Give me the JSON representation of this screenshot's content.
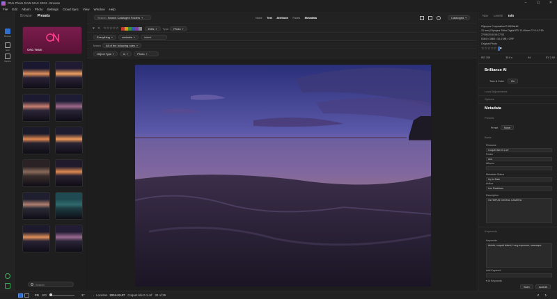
{
  "window": {
    "title": "ON1 Photo RAW MAX 2024 - Browse",
    "controls": [
      "–",
      "▢",
      "✕"
    ]
  },
  "menu": [
    "File",
    "Edit",
    "Album",
    "Photo",
    "Settings",
    "Cloud Sync",
    "View",
    "Window",
    "Help"
  ],
  "tools": [
    {
      "label": "Browse",
      "icon": "browse-icon"
    },
    {
      "label": "Edit",
      "icon": "edit-icon"
    },
    {
      "label": "Resize",
      "icon": "resize-icon"
    }
  ],
  "presets_panel": {
    "tabs": [
      "Browse",
      "Presets"
    ],
    "active_tab": "Presets",
    "featured_label": "ON1 Team",
    "search_placeholder": "Search"
  },
  "filter_bar": {
    "search_label": "Search",
    "search_scope": "Search Cataloged Folders",
    "view_tabs": [
      "None",
      "Text",
      "Attribute",
      "Faces",
      "Metadata"
    ],
    "active_view_tab": "Metadata",
    "catalog_label": "Cataloged",
    "edits_label": "Edits",
    "type_label": "Type",
    "type_value": "Photo",
    "rule_field": "Everything",
    "rule_op": "contains",
    "rule_value": "island",
    "match_label": "Match",
    "match_value": "All of the following rules",
    "rule2_field": "Object Type",
    "rule2_op": "is",
    "rule2_value": "Photo"
  },
  "right_panel": {
    "tabs": [
      "Nav",
      "Levels",
      "Info"
    ],
    "active_tab": "Info",
    "camera": "Olympus Corporation E-M1MarkII",
    "lens": "12 mm (Olympus Zuiko Digital ED 12-40mm F2.8 4-2.50",
    "date": "27/06/2016 06:27:53",
    "dims": "5184 x 3888 • 16.4 MB • ORF",
    "original": "Original Photo",
    "exif": [
      "ISO 200",
      "30.0 s",
      "f/4",
      "EV 2.00"
    ],
    "brilliance_title": "Brilliance AI",
    "tone_color_label": "Tone & Color",
    "tone_color_value": "On",
    "local_adjustments": "Local Adjustments",
    "options": "Options",
    "metadata_title": "Metadata",
    "presets_label": "Presets",
    "preset_label": "Preset",
    "preset_value": "None",
    "basic_label": "Basic",
    "fields": [
      {
        "label": "Filename",
        "value": "Coquet isle 0-1.orf"
      },
      {
        "label": "Folder",
        "value": "raw"
      },
      {
        "label": "Albums",
        "value": ""
      },
      {
        "label": "Metadata Status",
        "value": "Up to Date"
      },
      {
        "label": "Author",
        "value": "Ivor Rackham"
      },
      {
        "label": "Description",
        "value": "OLYMPUS DIGITAL CAMERA"
      }
    ],
    "keywords_section": "Keywords",
    "keywords_label": "Keywords",
    "keywords_value": "Amble, coquet island, Long exposure, seascape",
    "add_keyword_label": "Add Keyword",
    "ai_keywords": "AI Keywords",
    "scan_button": "Scan",
    "add_all_button": "Add All"
  },
  "bottom_bar": {
    "sort_label": "FN",
    "zoom_value": "100",
    "count_value": "37",
    "location_label": "Location",
    "location_date": "2024-03-07",
    "file_label": "Coquet isle 0-1.orf",
    "page_info": "30 of 39"
  }
}
